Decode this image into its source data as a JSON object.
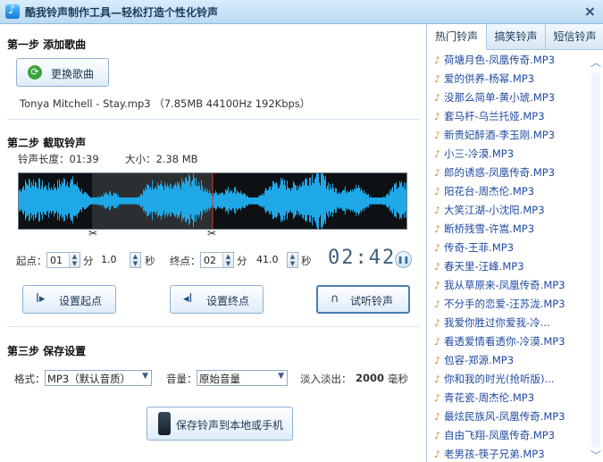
{
  "window": {
    "title": "酷我铃声制作工具—轻松打造个性化铃声",
    "close": "×"
  },
  "step1": {
    "heading": "第一步  添加歌曲",
    "change_button": "更换歌曲",
    "file_info": "Tonya Mitchell - Stay.mp3 （7.85MB 44100Hz  192Kbps）"
  },
  "step2": {
    "heading": "第二步  截取铃声",
    "length_label": "铃声长度：01:39",
    "size_label": "大小：2.38 MB",
    "start_label": "起点：",
    "start_min": "01",
    "min_unit": "分",
    "start_sec": "1.0",
    "sec_unit": "秒",
    "end_label": "终点：",
    "end_min": "02",
    "end_sec": "41.0",
    "time_display": "02:42",
    "set_start_button": "设置起点",
    "set_end_button": "设置终点",
    "preview_button": "试听铃声"
  },
  "step3": {
    "heading": "第三步  保存设置",
    "format_label": "格式：",
    "format_value": "MP3（默认音质）",
    "volume_label": "音量：",
    "volume_value": "原始音量",
    "fade_label": "淡入淡出：",
    "fade_value": "2000",
    "fade_unit": "毫秒",
    "save_button": "保存铃声到本地或手机"
  },
  "sidebar": {
    "tabs": [
      "热门铃声",
      "搞笑铃声",
      "短信铃声"
    ],
    "active_tab": 0,
    "items": [
      "荷塘月色-凤凰传奇.MP3",
      "爱的供养-杨幂.MP3",
      "没那么简单-黄小琥.MP3",
      "套马杆-乌兰托娅.MP3",
      "新贵妃醉酒-李玉刚.MP3",
      "小三-冷漠.MP3",
      "郎的诱惑-凤凰传奇.MP3",
      "阳花台-周杰伦.MP3",
      "大笑江湖-小沈阳.MP3",
      "断桥残雪-许嵩.MP3",
      "传奇-王菲.MP3",
      "春天里-汪峰.MP3",
      "我从草原来-凤凰传奇.MP3",
      "不分手的恋爱-汪苏泷.MP3",
      "我爱你胜过你爱我-冷...",
      "看透爱情看透你-冷漠.MP3",
      "包容-郑源.MP3",
      "你和我的时光(抢听版)...",
      "青花瓷-周杰伦.MP3",
      "最炫民族风-凤凰传奇.MP3",
      "自由飞翔-凤凰传奇.MP3",
      "老男孩-筷子兄弟.MP3"
    ]
  },
  "colors": {
    "wave": "#1ea8e8",
    "wave_dark": "#0e1113",
    "selection": "#2c2f31",
    "marker": "#e03030",
    "link": "#1f4aa0"
  }
}
